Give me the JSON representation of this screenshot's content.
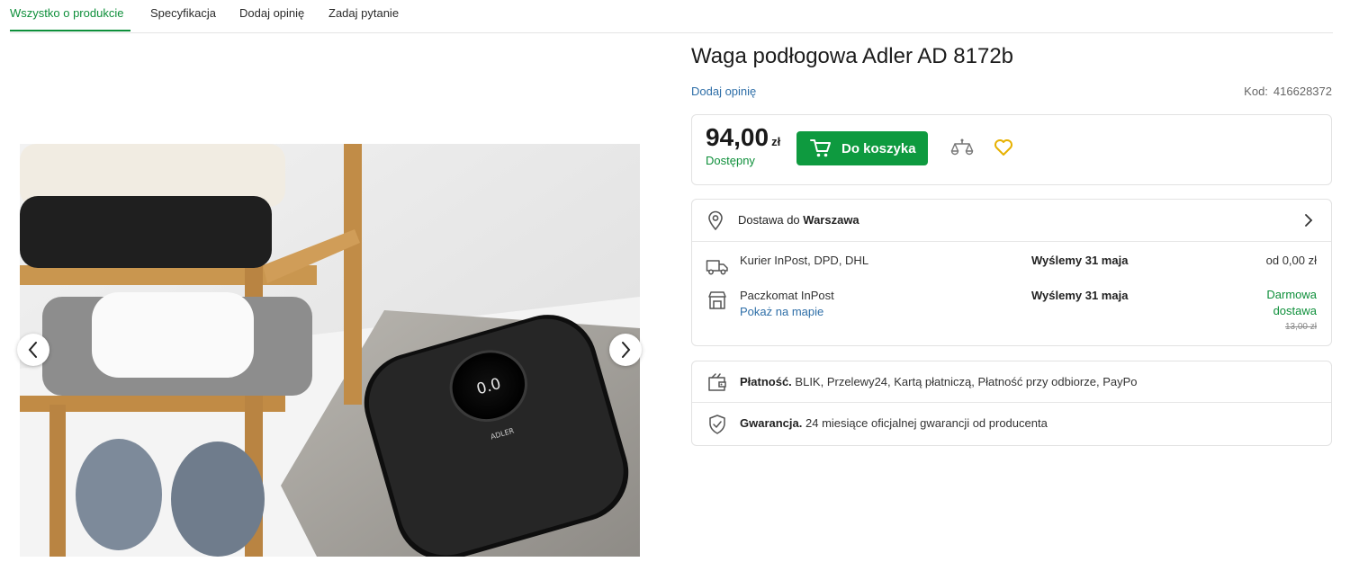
{
  "tabs": [
    {
      "label": "Wszystko o produkcie",
      "active": true
    },
    {
      "label": "Specyfikacja",
      "active": false
    },
    {
      "label": "Dodaj opinię",
      "active": false
    },
    {
      "label": "Zadaj pytanie",
      "active": false
    }
  ],
  "gallery": {
    "image_text": "ADLER",
    "display_reading": "0.0"
  },
  "product": {
    "title": "Waga podłogowa Adler AD 8172b",
    "add_review": "Dodaj opinię",
    "code_label": "Kod:",
    "code_value": "416628372"
  },
  "purchase": {
    "price": "94,00",
    "currency": "zł",
    "availability": "Dostępny",
    "cart_button": "Do koszyka"
  },
  "delivery": {
    "heading_prefix": "Dostawa do",
    "city": "Warszawa",
    "options": [
      {
        "name": "Kurier InPost, DPD, DHL",
        "ship": "Wyślemy 31 maja",
        "price": "od 0,00 zł"
      },
      {
        "name": "Paczkomat InPost",
        "link": "Pokaż na mapie",
        "ship": "Wyślemy 31 maja",
        "price": "Darmowa dostawa",
        "old_price": "13,00 zł"
      }
    ]
  },
  "info": {
    "payment_label": "Płatność.",
    "payment_text": "BLIK, Przelewy24, Kartą płatniczą, Płatność przy odbiorze, PayPo",
    "warranty_label": "Gwarancja.",
    "warranty_text": "24 miesiące oficjalnej gwarancji od producenta"
  },
  "colors": {
    "accent": "#0e8f3a",
    "button": "#0e9a3f",
    "link": "#2f6fa8",
    "favorite": "#e7b100"
  },
  "icons": [
    "cart-icon",
    "compare-scale-icon",
    "heart-icon",
    "map-pin-icon",
    "chevron-right-icon",
    "truck-icon",
    "parcel-locker-icon",
    "wallet-icon",
    "shield-check-icon",
    "arrow-left-icon",
    "arrow-right-icon"
  ]
}
